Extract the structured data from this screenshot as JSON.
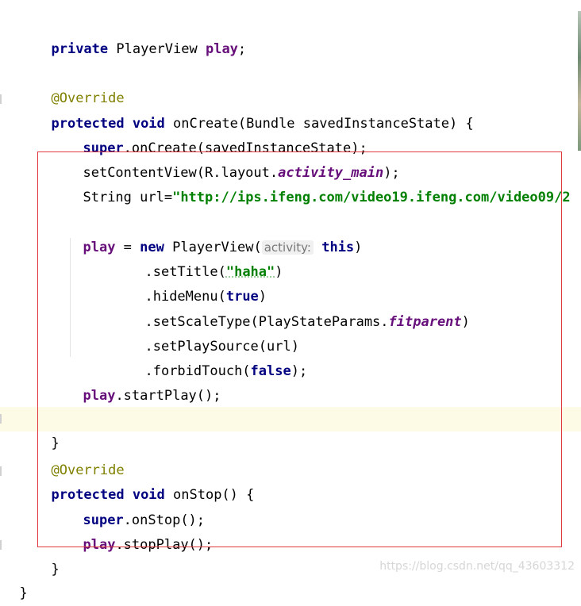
{
  "code": {
    "l1": {
      "kw": "private",
      "rest1": " PlayerView ",
      "field": "play",
      "rest2": ";"
    },
    "l2": {
      "ann": "@Override"
    },
    "l3": {
      "kw": "protected void",
      "rest": " onCreate(Bundle savedInstanceState) {"
    },
    "l4": {
      "kw": "super",
      "rest": ".onCreate(savedInstanceState);"
    },
    "l5": {
      "pre": "setContentView(R.layout.",
      "ital": "activity_main",
      "post": ");"
    },
    "l6": {
      "pre": "String url=",
      "str": "\"http://ips.ifeng.com/video19.ifeng.com/video09/2"
    },
    "l7": {
      "field": "play",
      "mid": " = ",
      "kw": "new",
      "rest": " PlayerView(",
      "hint": "activity:",
      "kw2": "this",
      "end": ")"
    },
    "l8": {
      "pre": ".setTitle(",
      "str": "\"haha\"",
      "post": ")"
    },
    "l9": {
      "pre": ".hideMenu(",
      "kw": "true",
      "post": ")"
    },
    "l10": {
      "pre": ".setScaleType(PlayStateParams.",
      "ital": "fitparent",
      "post": ")"
    },
    "l11": {
      "text": ".setPlaySource(url)"
    },
    "l12": {
      "pre": ".forbidTouch(",
      "kw": "false",
      "post": ");"
    },
    "l13": {
      "field": "play",
      "rest": ".startPlay();"
    },
    "l14": {
      "text": "}"
    },
    "l15": {
      "ann": "@Override"
    },
    "l16": {
      "kw": "protected void",
      "rest": " onStop() {"
    },
    "l17": {
      "kw": "super",
      "rest": ".onStop();"
    },
    "l18": {
      "field": "play",
      "rest": ".stopPlay();"
    },
    "l19": {
      "text": "}"
    },
    "l20": {
      "text": "}"
    }
  },
  "watermark": "https://blog.csdn.net/qq_43603312",
  "colors": {
    "keyword": "#000080",
    "annotation": "#808000",
    "string": "#008000",
    "field": "#660e7a",
    "box": "#e0393d"
  }
}
